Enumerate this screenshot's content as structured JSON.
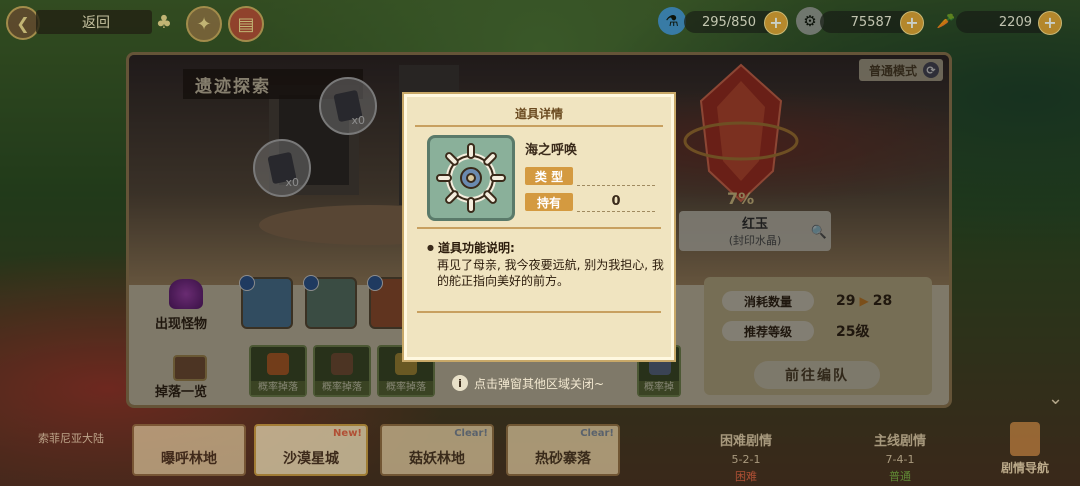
{
  "topbar": {
    "back_label": "返回",
    "back_icon": "arrow-left-icon",
    "resources": [
      {
        "name": "stamina",
        "icon": "potion-icon",
        "value": "295/850"
      },
      {
        "name": "coins",
        "icon": "coin-icon",
        "value": "75587"
      },
      {
        "name": "carrots",
        "icon": "carrot-icon",
        "value": "2209"
      }
    ]
  },
  "panel": {
    "title": "遗迹探索",
    "mode": "普通模式",
    "relics": [
      {
        "count": "x0"
      },
      {
        "count": "x0"
      }
    ],
    "target_drop": {
      "percent": "7%",
      "name": "红玉",
      "subtitle": "(封印水晶)"
    },
    "monsters_label": "出现怪物",
    "drops_label": "掉落一览",
    "drop_slots": [
      {
        "label": "概率掉落"
      },
      {
        "label": "概率掉落"
      },
      {
        "label": "概率掉落"
      },
      {
        "label": "概率掉"
      }
    ],
    "stats": {
      "cost_label": "消耗数量",
      "cost_from": "29",
      "cost_to": "28",
      "level_label": "推荐等级",
      "level_value": "25级",
      "go_button": "前往编队"
    }
  },
  "modal": {
    "header": "道具详情",
    "item_name": "海之呼唤",
    "type_label": "类 型",
    "type_value": "",
    "owned_label": "持有",
    "owned_value": "0",
    "desc_title": "道具功能说明:",
    "desc_text": "再见了母亲, 我今夜要远航, 别为我担心, 我的舵正指向美好的前方。"
  },
  "close_hint": "点击弹窗其他区域关闭~",
  "bottom": {
    "region": "索菲尼亚大陆",
    "stages": [
      {
        "name": "曝呼林地",
        "flag": ""
      },
      {
        "name": "沙漠星城",
        "flag": "New!"
      },
      {
        "name": "菇妖林地",
        "flag": "Clear!"
      },
      {
        "name": "热砂寨落",
        "flag": "Clear!"
      }
    ],
    "hard_story": {
      "title": "困难剧情",
      "stage": "5-2-1",
      "diff": "困难"
    },
    "main_story": {
      "title": "主线剧情",
      "stage": "7-4-1",
      "diff": "普通"
    },
    "nav": "剧情导航"
  },
  "colors": {
    "accent": "#e4a030",
    "modal_bg": "#f0e4c0",
    "tag_orange": "#d49a40"
  }
}
